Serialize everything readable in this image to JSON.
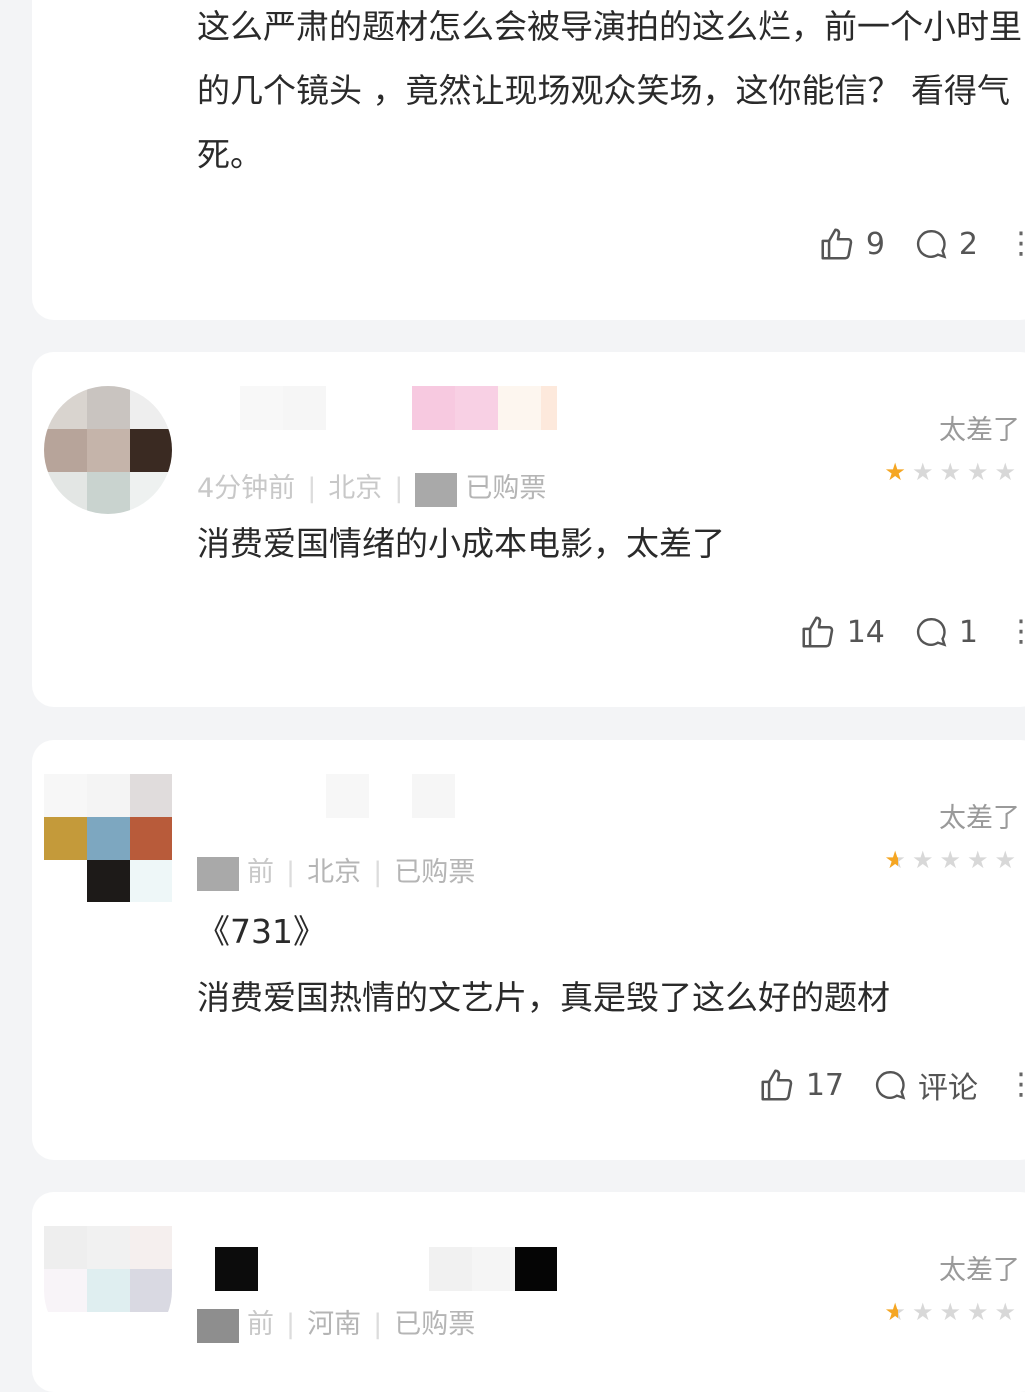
{
  "reviews": [
    {
      "comment": "这么严肃的题材怎么会被导演拍的这么烂，前一个小时里的几个镜头 ，竟然让现场观众笑场，这你能信？ 看得气死。",
      "likes": "9",
      "replies": "2"
    },
    {
      "meta_time": "4分钟前",
      "meta_location": "北京",
      "meta_ticket": "已购票",
      "rating_label": "太差了",
      "stars": 1,
      "comment": "消费爱国情绪的小成本电影，太差了",
      "likes": "14",
      "replies": "1"
    },
    {
      "meta_time": "前",
      "meta_location": "北京",
      "meta_ticket": "已购票",
      "rating_label": "太差了",
      "stars": 0.5,
      "comment_line1": "《731》",
      "comment_line2": "消费爱国热情的文艺片，真是毁了这么好的题材",
      "likes": "17",
      "replies": "评论"
    },
    {
      "meta_time": "前",
      "meta_location": "河南",
      "meta_ticket": "已购票",
      "rating_label": "太差了",
      "stars": 0.5
    }
  ],
  "colors": {
    "star_on": "#f5a623",
    "star_off": "#d8d8d8",
    "background": "#f3f4f6"
  },
  "icons": {
    "like": "thumbs-up-icon",
    "reply": "comment-bubble-icon",
    "more": "vertical-ellipsis-icon",
    "star": "star-icon"
  }
}
